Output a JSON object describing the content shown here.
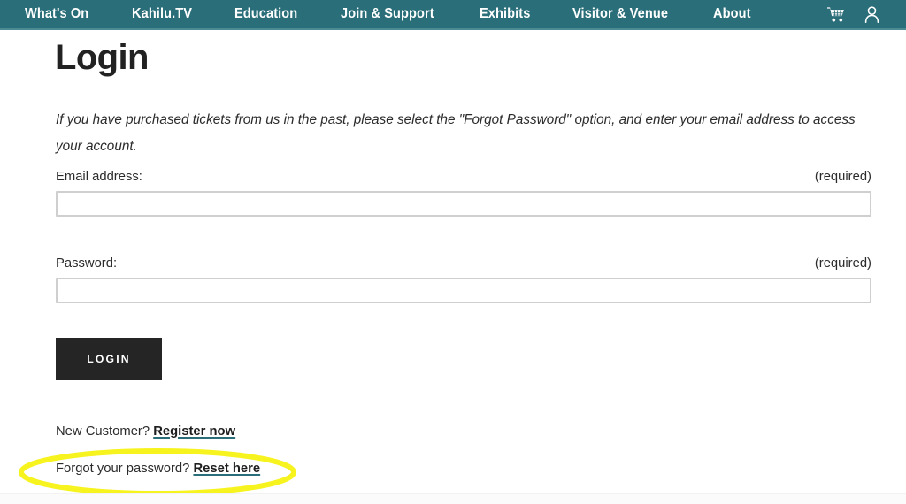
{
  "nav": {
    "background_color": "#2a6e79",
    "items": [
      {
        "label": "What's On",
        "name": "nav-item-whats-on"
      },
      {
        "label": "Kahilu.TV",
        "name": "nav-item-kahilu-tv"
      },
      {
        "label": "Education",
        "name": "nav-item-education"
      },
      {
        "label": "Join & Support",
        "name": "nav-item-join-support"
      },
      {
        "label": "Exhibits",
        "name": "nav-item-exhibits"
      },
      {
        "label": "Visitor & Venue",
        "name": "nav-item-visitor-venue"
      },
      {
        "label": "About",
        "name": "nav-item-about"
      }
    ],
    "icons": [
      {
        "name": "shopping-cart-icon",
        "label": "Cart"
      },
      {
        "name": "user-account-icon",
        "label": "Account"
      }
    ]
  },
  "page": {
    "title": "Login",
    "intro": "If you have purchased tickets from us in the past, please select the \"Forgot Password\" option, and enter your email address to access your account."
  },
  "form": {
    "email": {
      "label": "Email address:",
      "required_note": "(required)",
      "value": "",
      "placeholder": ""
    },
    "password": {
      "label": "Password:",
      "required_note": "(required)",
      "value": "",
      "placeholder": ""
    },
    "submit_label": "Login"
  },
  "footer_links": {
    "new_customer_prefix": "New Customer? ",
    "register_link": "Register now",
    "forgot_prefix": "Forgot your password? ",
    "reset_link": "Reset here"
  },
  "annotation": {
    "type": "ellipse-highlight",
    "color": "#f7f31e",
    "targets": "Forgot your password? Reset here"
  }
}
